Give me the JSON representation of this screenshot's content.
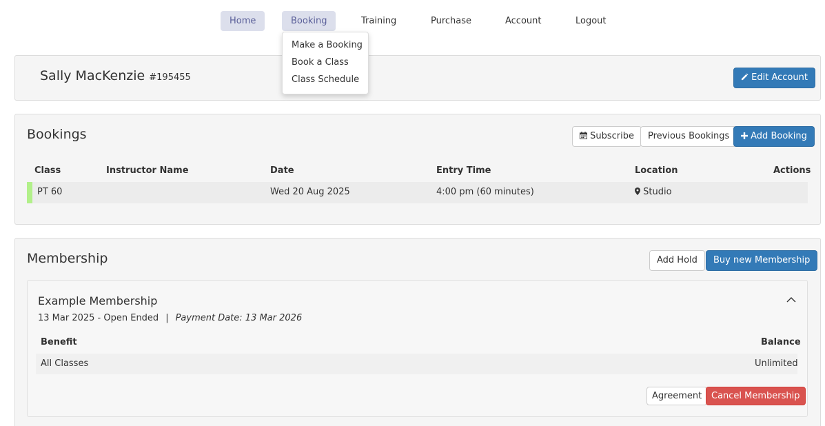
{
  "nav": {
    "items": [
      {
        "label": "Home"
      },
      {
        "label": "Booking"
      },
      {
        "label": "Training"
      },
      {
        "label": "Purchase"
      },
      {
        "label": "Account"
      },
      {
        "label": "Logout"
      }
    ],
    "dropdown": {
      "items": [
        {
          "label": "Make a Booking"
        },
        {
          "label": "Book a Class"
        },
        {
          "label": "Class Schedule"
        }
      ]
    }
  },
  "profile": {
    "name": "Sally MacKenzie",
    "id": "#195455",
    "edit_label": "Edit Account"
  },
  "bookings": {
    "title": "Bookings",
    "subscribe_label": "Subscribe",
    "previous_label": "Previous Bookings",
    "add_label": "Add Booking",
    "columns": [
      "Class",
      "Instructor Name",
      "Date",
      "Entry Time",
      "Location",
      "Actions"
    ],
    "rows": [
      {
        "class": "PT 60",
        "instructor": "",
        "date": "Wed 20 Aug 2025",
        "time": "4:00 pm (60 minutes)",
        "location": "Studio"
      }
    ]
  },
  "membership": {
    "title": "Membership",
    "add_hold_label": "Add Hold",
    "buy_label": "Buy new Membership",
    "card": {
      "title": "Example Membership",
      "period": "13 Mar 2025 - Open Ended",
      "separator": "|",
      "payment": "Payment Date: 13 Mar 2026",
      "columns": [
        "Benefit",
        "Balance"
      ],
      "benefits": [
        {
          "benefit": "All Classes",
          "balance": "Unlimited"
        }
      ],
      "agreement_label": "Agreement",
      "cancel_label": "Cancel Membership"
    }
  },
  "colors": {
    "primary": "#337ab7",
    "danger": "#d9534f",
    "nav_active_bg": "#dcdfec",
    "row_marker": "#b2f08a"
  }
}
